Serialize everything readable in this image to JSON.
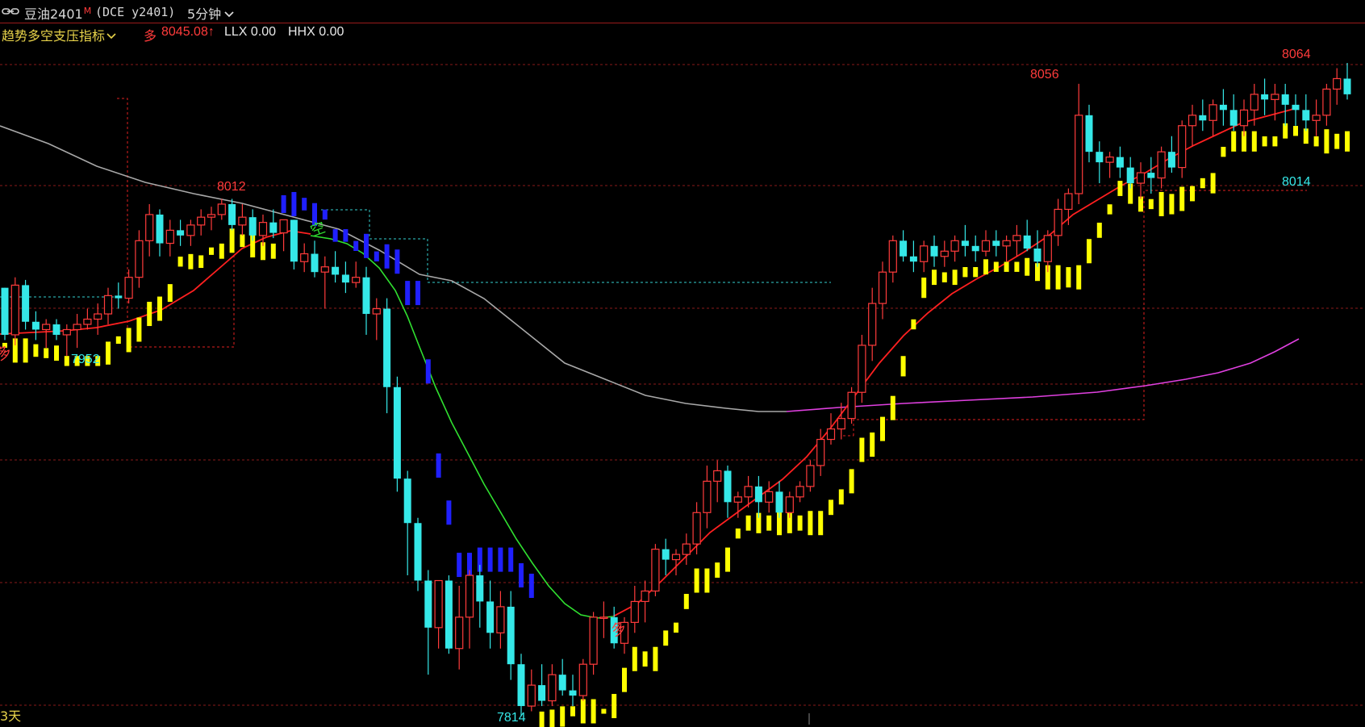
{
  "header": {
    "symbol_name": "豆油2401",
    "symbol_flag": "M",
    "symbol_code": "(DCE y2401)",
    "period": "5分钟",
    "period_icon": "chevron-down-icon",
    "link_icon": "chain-link-icon"
  },
  "indicator_bar": {
    "name": "趋势多空支压指标",
    "name_icon": "chevron-down-icon",
    "direction": "多",
    "value": "8045.08↑",
    "llx": "LLX 0.00",
    "hhx": "HHX 0.00"
  },
  "footer": {
    "left_text": "3天"
  },
  "annotations": {
    "high_left": "8012",
    "low_left": "7952",
    "low_main": "7814",
    "high_mid": "8056",
    "high_right": "8064",
    "support_right": "8014",
    "signal_short": "空",
    "signal_long_mid": "多",
    "signal_long_left": "多"
  },
  "colors": {
    "background": "#000000",
    "up_candle": "#ff3b3b",
    "down_candle": "#35e8e8",
    "grid": "#8a1a1a",
    "ma_red": "#ff2020",
    "ma_gray": "#a8a8a8",
    "ma_magenta": "#e040e0",
    "ma_green": "#30e030",
    "trail_yellow": "#ffff00",
    "trail_blue": "#2020ff",
    "text_yellow": "#e8d34a"
  },
  "chart_data": {
    "type": "candlestick",
    "title": "豆油2401 (DCE y2401) 5分钟",
    "ylim": [
      7814,
      8064
    ],
    "candles": [
      [
        7978,
        7978,
        7958,
        7960
      ],
      [
        7960,
        7982,
        7956,
        7979
      ],
      [
        7979,
        7981,
        7962,
        7965
      ],
      [
        7965,
        7969,
        7958,
        7962
      ],
      [
        7962,
        7966,
        7955,
        7964
      ],
      [
        7964,
        7966,
        7958,
        7960
      ],
      [
        7960,
        7964,
        7952,
        7962
      ],
      [
        7962,
        7968,
        7955,
        7964
      ],
      [
        7964,
        7970,
        7962,
        7966
      ],
      [
        7966,
        7972,
        7960,
        7968
      ],
      [
        7968,
        7978,
        7964,
        7975
      ],
      [
        7975,
        7980,
        7970,
        7974
      ],
      [
        7974,
        7985,
        7972,
        7982
      ],
      [
        7982,
        8000,
        7978,
        7996
      ],
      [
        7996,
        8010,
        7990,
        8006
      ],
      [
        8006,
        8008,
        7990,
        7995
      ],
      [
        7995,
        8004,
        7990,
        8000
      ],
      [
        8000,
        8004,
        7994,
        7998
      ],
      [
        7998,
        8004,
        7994,
        8002
      ],
      [
        8002,
        8008,
        7998,
        8005
      ],
      [
        8005,
        8009,
        8000,
        8006
      ],
      [
        8006,
        8012,
        8004,
        8010
      ],
      [
        8010,
        8012,
        8000,
        8002
      ],
      [
        8002,
        8010,
        7998,
        8005
      ],
      [
        8005,
        8008,
        7996,
        7998
      ],
      [
        7998,
        8006,
        7994,
        8003
      ],
      [
        8003,
        8008,
        7997,
        7999
      ],
      [
        7999,
        8004,
        7992,
        8004
      ],
      [
        8004,
        8004,
        7985,
        7988
      ],
      [
        7988,
        7995,
        7984,
        7991
      ],
      [
        7991,
        7996,
        7982,
        7984
      ],
      [
        7984,
        7990,
        7970,
        7986
      ],
      [
        7986,
        7992,
        7980,
        7983
      ],
      [
        7983,
        7988,
        7976,
        7980
      ],
      [
        7980,
        7988,
        7978,
        7982
      ],
      [
        7982,
        7986,
        7960,
        7968
      ],
      [
        7968,
        7974,
        7958,
        7970
      ],
      [
        7970,
        7974,
        7930,
        7940
      ],
      [
        7940,
        7944,
        7900,
        7905
      ],
      [
        7905,
        7908,
        7868,
        7888
      ],
      [
        7888,
        7890,
        7862,
        7866
      ],
      [
        7866,
        7870,
        7830,
        7848
      ],
      [
        7848,
        7866,
        7840,
        7866
      ],
      [
        7866,
        7868,
        7838,
        7840
      ],
      [
        7840,
        7864,
        7832,
        7852
      ],
      [
        7852,
        7870,
        7840,
        7868
      ],
      [
        7868,
        7872,
        7848,
        7858
      ],
      [
        7858,
        7866,
        7840,
        7846
      ],
      [
        7846,
        7862,
        7840,
        7856
      ],
      [
        7856,
        7862,
        7828,
        7834
      ],
      [
        7834,
        7838,
        7814,
        7818
      ],
      [
        7818,
        7832,
        7816,
        7826
      ],
      [
        7826,
        7834,
        7818,
        7820
      ],
      [
        7820,
        7834,
        7818,
        7830
      ],
      [
        7830,
        7836,
        7822,
        7824
      ],
      [
        7824,
        7830,
        7818,
        7822
      ],
      [
        7822,
        7836,
        7820,
        7834
      ],
      [
        7834,
        7854,
        7830,
        7852
      ],
      [
        7852,
        7858,
        7844,
        7852
      ],
      [
        7852,
        7856,
        7840,
        7842
      ],
      [
        7842,
        7852,
        7838,
        7850
      ],
      [
        7850,
        7864,
        7846,
        7858
      ],
      [
        7858,
        7866,
        7850,
        7862
      ],
      [
        7862,
        7880,
        7860,
        7878
      ],
      [
        7878,
        7882,
        7868,
        7874
      ],
      [
        7874,
        7878,
        7868,
        7876
      ],
      [
        7876,
        7884,
        7872,
        7880
      ],
      [
        7880,
        7896,
        7876,
        7892
      ],
      [
        7892,
        7910,
        7886,
        7904
      ],
      [
        7904,
        7912,
        7896,
        7908
      ],
      [
        7908,
        7910,
        7890,
        7896
      ],
      [
        7896,
        7900,
        7890,
        7898
      ],
      [
        7898,
        7906,
        7894,
        7902
      ],
      [
        7902,
        7906,
        7890,
        7896
      ],
      [
        7896,
        7904,
        7892,
        7900
      ],
      [
        7900,
        7904,
        7890,
        7892
      ],
      [
        7892,
        7900,
        7890,
        7898
      ],
      [
        7898,
        7904,
        7896,
        7902
      ],
      [
        7902,
        7912,
        7900,
        7910
      ],
      [
        7910,
        7924,
        7906,
        7920
      ],
      [
        7920,
        7930,
        7918,
        7924
      ],
      [
        7924,
        7934,
        7920,
        7928
      ],
      [
        7928,
        7940,
        7926,
        7938
      ],
      [
        7938,
        7960,
        7934,
        7956
      ],
      [
        7956,
        7978,
        7950,
        7972
      ],
      [
        7972,
        7988,
        7966,
        7984
      ],
      [
        7984,
        7998,
        7980,
        7996
      ],
      [
        7996,
        8000,
        7988,
        7990
      ],
      [
        7990,
        7996,
        7984,
        7988
      ],
      [
        7988,
        7996,
        7984,
        7994
      ],
      [
        7994,
        7998,
        7986,
        7990
      ],
      [
        7990,
        7996,
        7986,
        7992
      ],
      [
        7992,
        7998,
        7988,
        7996
      ],
      [
        7996,
        8002,
        7990,
        7994
      ],
      [
        7994,
        7998,
        7988,
        7992
      ],
      [
        7992,
        8000,
        7990,
        7996
      ],
      [
        7996,
        8000,
        7990,
        7994
      ],
      [
        7994,
        7998,
        7988,
        7996
      ],
      [
        7996,
        8002,
        7990,
        7998
      ],
      [
        7998,
        8004,
        7992,
        7993
      ],
      [
        7993,
        8000,
        7986,
        7988
      ],
      [
        7988,
        8000,
        7984,
        7998
      ],
      [
        7998,
        8012,
        7994,
        8008
      ],
      [
        8008,
        8016,
        8002,
        8014
      ],
      [
        8014,
        8056,
        8010,
        8044
      ],
      [
        8044,
        8048,
        8026,
        8030
      ],
      [
        8030,
        8034,
        8018,
        8026
      ],
      [
        8026,
        8030,
        8020,
        8028
      ],
      [
        8028,
        8032,
        8020,
        8024
      ],
      [
        8024,
        8028,
        8016,
        8018
      ],
      [
        8018,
        8026,
        8012,
        8022
      ],
      [
        8022,
        8028,
        8014,
        8020
      ],
      [
        8020,
        8032,
        8016,
        8030
      ],
      [
        8030,
        8036,
        8022,
        8024
      ],
      [
        8024,
        8042,
        8020,
        8040
      ],
      [
        8040,
        8048,
        8032,
        8044
      ],
      [
        8044,
        8050,
        8038,
        8042
      ],
      [
        8042,
        8050,
        8036,
        8048
      ],
      [
        8048,
        8054,
        8040,
        8046
      ],
      [
        8046,
        8052,
        8038,
        8040
      ],
      [
        8040,
        8050,
        8036,
        8046
      ],
      [
        8046,
        8056,
        8040,
        8052
      ],
      [
        8052,
        8058,
        8044,
        8050
      ],
      [
        8050,
        8056,
        8042,
        8052
      ],
      [
        8052,
        8056,
        8040,
        8048
      ],
      [
        8048,
        8052,
        8040,
        8046
      ],
      [
        8046,
        8052,
        8038,
        8042
      ],
      [
        8042,
        8050,
        8036,
        8044
      ],
      [
        8044,
        8056,
        8040,
        8054
      ],
      [
        8054,
        8062,
        8048,
        8058
      ],
      [
        8058,
        8064,
        8050,
        8052
      ]
    ],
    "indicators": [
      {
        "name": "MA-red",
        "color": "#ff2020"
      },
      {
        "name": "MA-gray",
        "color": "#a8a8a8"
      },
      {
        "name": "MA-magenta",
        "color": "#e040e0"
      },
      {
        "name": "MA-green",
        "color": "#30e030"
      },
      {
        "name": "trail-stop",
        "colors": [
          "#ffff00",
          "#2020ff"
        ]
      }
    ]
  }
}
